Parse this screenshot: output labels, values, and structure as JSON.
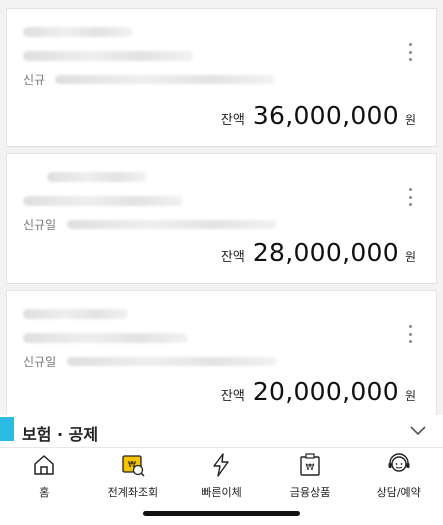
{
  "accounts": [
    {
      "prefix": "신규",
      "balance_label": "잔액",
      "balance": "36,000,000",
      "unit": "원"
    },
    {
      "prefix": "신규일",
      "balance_label": "잔액",
      "balance": "28,000,000",
      "unit": "원"
    },
    {
      "prefix": "신규일",
      "balance_label": "잔액",
      "balance": "20,000,000",
      "unit": "원"
    }
  ],
  "section": {
    "title": "보험 · 공제",
    "accent_color": "#2bbce4",
    "toggle_icon": "chevron-down-icon"
  },
  "tabbar": {
    "items": [
      {
        "label": "홈",
        "icon": "home-icon"
      },
      {
        "label": "전계좌조회",
        "icon": "all-accounts-icon",
        "accent": "#f5c400"
      },
      {
        "label": "빠른이체",
        "icon": "lightning-icon"
      },
      {
        "label": "금융상품",
        "icon": "won-product-icon"
      },
      {
        "label": "상담/예약",
        "icon": "headset-icon"
      }
    ]
  }
}
